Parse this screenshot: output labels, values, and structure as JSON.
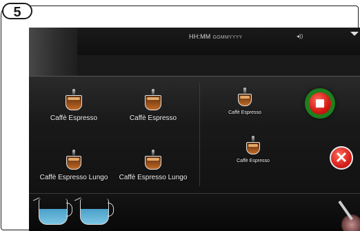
{
  "step_number": "5",
  "status_bar": {
    "time": "HH:MM",
    "date": "GGMMYYYY",
    "sound_icon": "speaker-icon",
    "menu_icon": "chevron-down-icon"
  },
  "drinks_left": [
    {
      "label": "Caffè Espresso",
      "icon": "espresso-cup-icon"
    },
    {
      "label": "Caffè Espresso",
      "icon": "double-espresso-cup-icon"
    },
    {
      "label": "Caffè Espresso Lungo",
      "icon": "lungo-cup-icon"
    },
    {
      "label": "Caffè Espresso Lungo",
      "icon": "double-lungo-cup-icon"
    }
  ],
  "drinks_right": [
    {
      "label": "Caffè Espresso",
      "icon": "espresso-cup-icon"
    },
    {
      "label": "Caffè Espresso",
      "icon": "double-espresso-cup-icon"
    }
  ],
  "buttons": {
    "stop_icon": "stop-icon",
    "cancel_icon": "close-icon",
    "cancel_glyph": "✕"
  },
  "bottom": {
    "jug_icons": [
      "milk-jug-icon",
      "water-jug-icon"
    ],
    "wand_icon": "steam-wand-icon"
  },
  "colors": {
    "stop_ring": "#1e7f1e",
    "stop_fill": "#d21812",
    "cancel_fill": "#d6211b",
    "screen_bg": "#121212"
  }
}
